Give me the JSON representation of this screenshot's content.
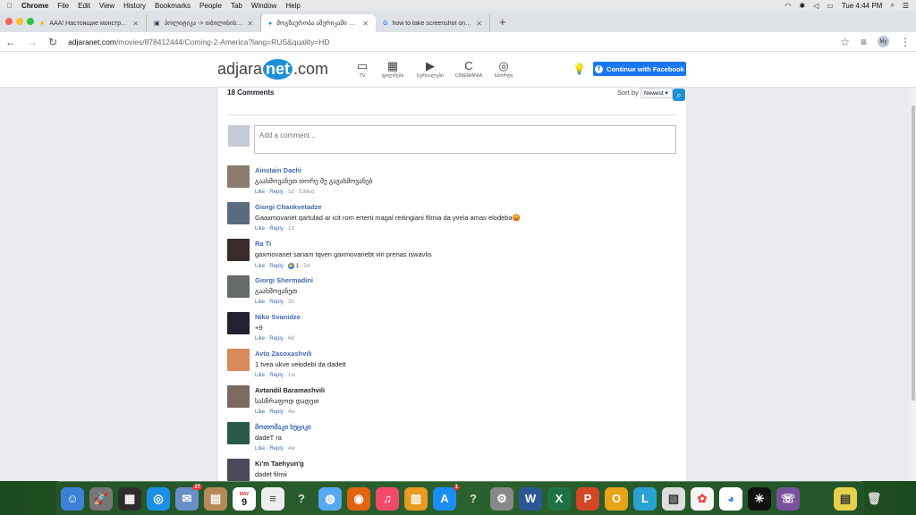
{
  "menubar": {
    "app": "Chrome",
    "items": [
      "File",
      "Edit",
      "View",
      "History",
      "Bookmarks",
      "People",
      "Tab",
      "Window",
      "Help"
    ],
    "clock": "Tue 4:44 PM"
  },
  "tabs": [
    {
      "title": "AAA! Настоящие монстры смотреть",
      "active": false
    },
    {
      "title": "პოლიტიკა -> თბილისის ფული",
      "active": false
    },
    {
      "title": "მოგზაურობა ამერიკაში 2 / C",
      "active": true
    },
    {
      "title": "how to take screenshot on imac",
      "active": false
    }
  ],
  "toolbar": {
    "url_host": "adjaranet.com",
    "url_path": "/movies/878412444/Coming-2-America?lang=RUS&quality=HD",
    "profile": "My"
  },
  "site": {
    "logo_pre": "adjara",
    "logo_net": "net",
    "logo_post": ".com",
    "nav": [
      {
        "label": "TV",
        "icon": "tv-icon",
        "glyph": "▭"
      },
      {
        "label": "ფილმები",
        "icon": "film-icon",
        "glyph": "▦"
      },
      {
        "label": "სერიალები",
        "icon": "play-icon",
        "glyph": "▶"
      },
      {
        "label": "CINEMANIA",
        "icon": "cinemania-icon",
        "glyph": "C"
      },
      {
        "label": "სპორტი",
        "icon": "ball-icon",
        "glyph": "◎"
      }
    ],
    "fb_button": "Continue with Facebook"
  },
  "comments_panel": {
    "count_label": "18 Comments",
    "sort_label": "Sort by",
    "sort_value": "Newest ▾",
    "placeholder": "Add a comment...",
    "like": "Like",
    "reply": "Reply",
    "comments": [
      {
        "name": "Ainstain Dachi",
        "text": "გაახმოვანეთ თორე მე გავახმოვანებ",
        "extra": "",
        "age": "1d",
        "edited": "Edited",
        "avatar_color": "#8a7a70",
        "link": true
      },
      {
        "name": "Giorgi Chankvetadze",
        "text": "Gaaxmovanet qartulad ar icit rom erterti magal reitingiani filmia da yvela amas elodeba😡",
        "extra": "",
        "age": "1d",
        "edited": "",
        "avatar_color": "#5a6b7d",
        "link": true
      },
      {
        "name": "Ra Ti",
        "text": "gaxmovanet sanam tqven gaxmovanebt viri prenas iswavlis",
        "extra": "1",
        "age": "2d",
        "edited": "",
        "avatar_color": "#3a2a2a",
        "link": true
      },
      {
        "name": "Giorgi Shermadini",
        "text": "გაახმოვანეთ",
        "extra": "",
        "age": "3d",
        "edited": "",
        "avatar_color": "#666a6a",
        "link": true
      },
      {
        "name": "Niko Svanidze",
        "text": "+9",
        "extra": "",
        "age": "6d",
        "edited": "",
        "avatar_color": "#222233",
        "link": true
      },
      {
        "name": "Avto Zasoxashvili",
        "text": "1 tvea ukve velodebi da dadett",
        "extra": "",
        "age": "1w",
        "edited": "",
        "avatar_color": "#d88a5a",
        "link": true
      },
      {
        "name": "Avtandil Baramashvili",
        "text": "სასწრაფოდ დადეთ",
        "extra": "",
        "age": "4w",
        "edited": "",
        "avatar_color": "#7a6a60",
        "link": false
      },
      {
        "name": "მოთოშაკი ხუციკი",
        "text": "dadeT ra",
        "extra": "",
        "age": "4w",
        "edited": "",
        "avatar_color": "#2a5a4a",
        "link": true
      },
      {
        "name": "Ki'm Taehyun'g",
        "text": "dadet filmii",
        "extra": "",
        "age": "",
        "edited": "",
        "avatar_color": "#4a4a5a",
        "link": false
      }
    ]
  },
  "dock": {
    "badges": [
      "27",
      "1"
    ],
    "calendar_month": "MAY",
    "calendar_day": "9"
  },
  "colors": {
    "accent": "#1e8fd9",
    "fb": "#1877f2",
    "link": "#4267b2"
  }
}
